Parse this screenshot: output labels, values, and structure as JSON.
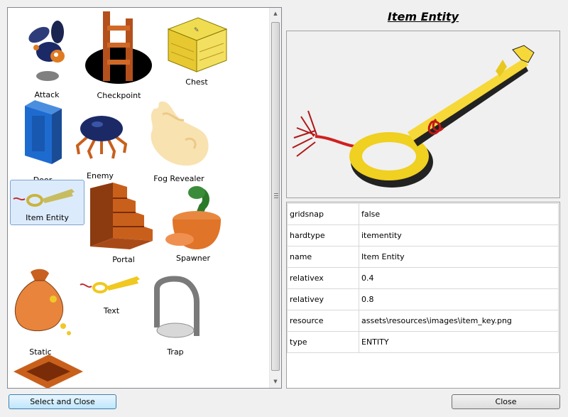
{
  "entities": [
    {
      "label": "Attack",
      "icon": "beetle-bomb-icon"
    },
    {
      "label": "Checkpoint",
      "icon": "ladder-hole-icon"
    },
    {
      "label": "Chest",
      "icon": "chest-icon"
    },
    {
      "label": "Door",
      "icon": "door-icon"
    },
    {
      "label": "Enemy",
      "icon": "spider-icon"
    },
    {
      "label": "Fog Revealer",
      "icon": "fog-icon"
    },
    {
      "label": "Item Entity",
      "icon": "key-icon",
      "selected": true
    },
    {
      "label": "Portal",
      "icon": "stairs-icon"
    },
    {
      "label": "Spawner",
      "icon": "snake-pot-icon"
    },
    {
      "label": "Static",
      "icon": "money-bag-icon"
    },
    {
      "label": "Text",
      "icon": "small-key-icon"
    },
    {
      "label": "Trap",
      "icon": "trap-icon"
    },
    {
      "label": "",
      "icon": "pit-icon"
    }
  ],
  "detail": {
    "title": "Item Entity",
    "preview_icon": "key-preview-icon"
  },
  "properties": [
    {
      "key": "gridsnap",
      "value": "false"
    },
    {
      "key": "hardtype",
      "value": "itementity"
    },
    {
      "key": "name",
      "value": "Item Entity"
    },
    {
      "key": "relativex",
      "value": "0.4"
    },
    {
      "key": "relativey",
      "value": "0.8"
    },
    {
      "key": "resource",
      "value": "assets\\resources\\images\\item_key.png"
    },
    {
      "key": "type",
      "value": "ENTITY"
    }
  ],
  "buttons": {
    "select_close": "Select and Close",
    "close": "Close"
  },
  "scroll": {
    "up": "▲",
    "down": "▼"
  }
}
